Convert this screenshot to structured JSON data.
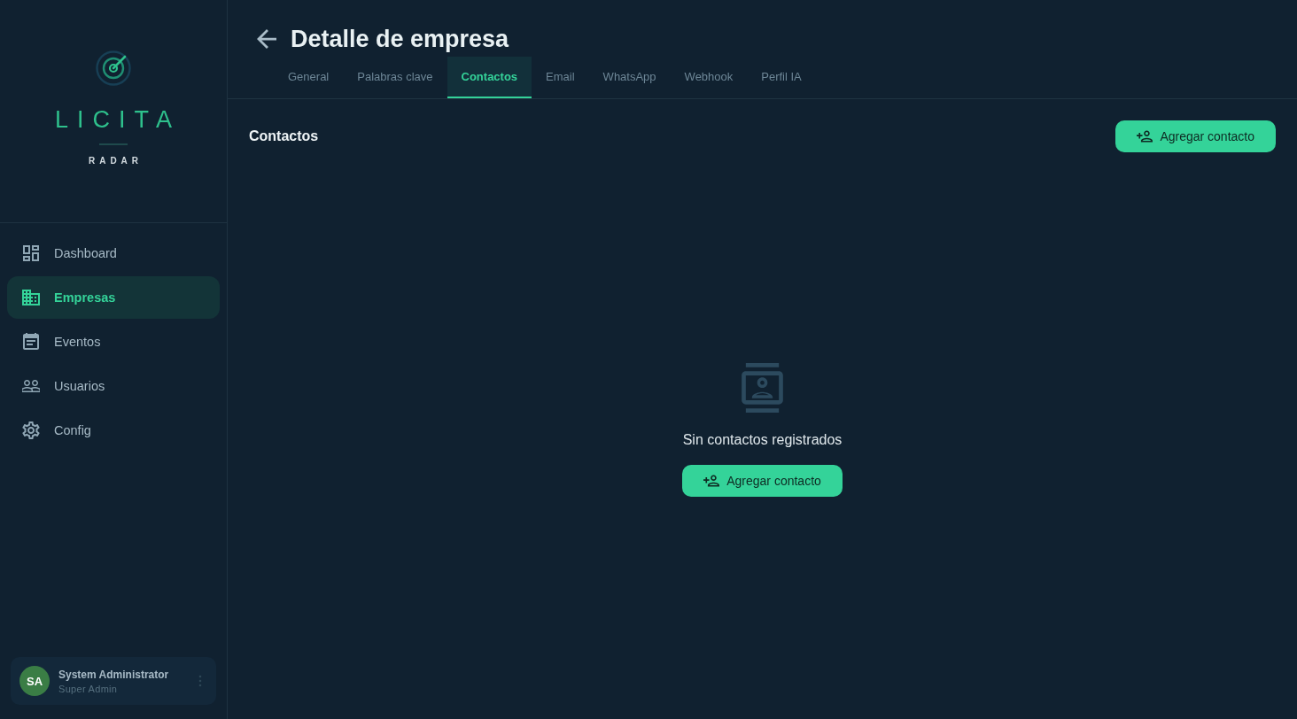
{
  "sidebar": {
    "logo": {
      "title": "LICITA",
      "subtitle": "RADAR"
    },
    "nav_items": [
      {
        "label": "Dashboard",
        "selected": false
      },
      {
        "label": "Empresas",
        "selected": true
      },
      {
        "label": "Eventos",
        "selected": false
      },
      {
        "label": "Usuarios",
        "selected": false
      },
      {
        "label": "Config",
        "selected": false
      }
    ],
    "user": {
      "initials": "SA",
      "name": "System Administrator",
      "role": "Super Admin"
    }
  },
  "header": {
    "title": "Detalle de empresa"
  },
  "tabs": [
    {
      "label": "General",
      "selected": false
    },
    {
      "label": "Palabras clave",
      "selected": false
    },
    {
      "label": "Contactos",
      "selected": true
    },
    {
      "label": "Email",
      "selected": false
    },
    {
      "label": "WhatsApp",
      "selected": false
    },
    {
      "label": "Webhook",
      "selected": false
    },
    {
      "label": "Perfil IA",
      "selected": false
    }
  ],
  "section": {
    "title": "Contactos",
    "add_button": "Agregar contacto"
  },
  "empty_state": {
    "message": "Sin contactos registrados",
    "button": "Agregar contacto"
  }
}
